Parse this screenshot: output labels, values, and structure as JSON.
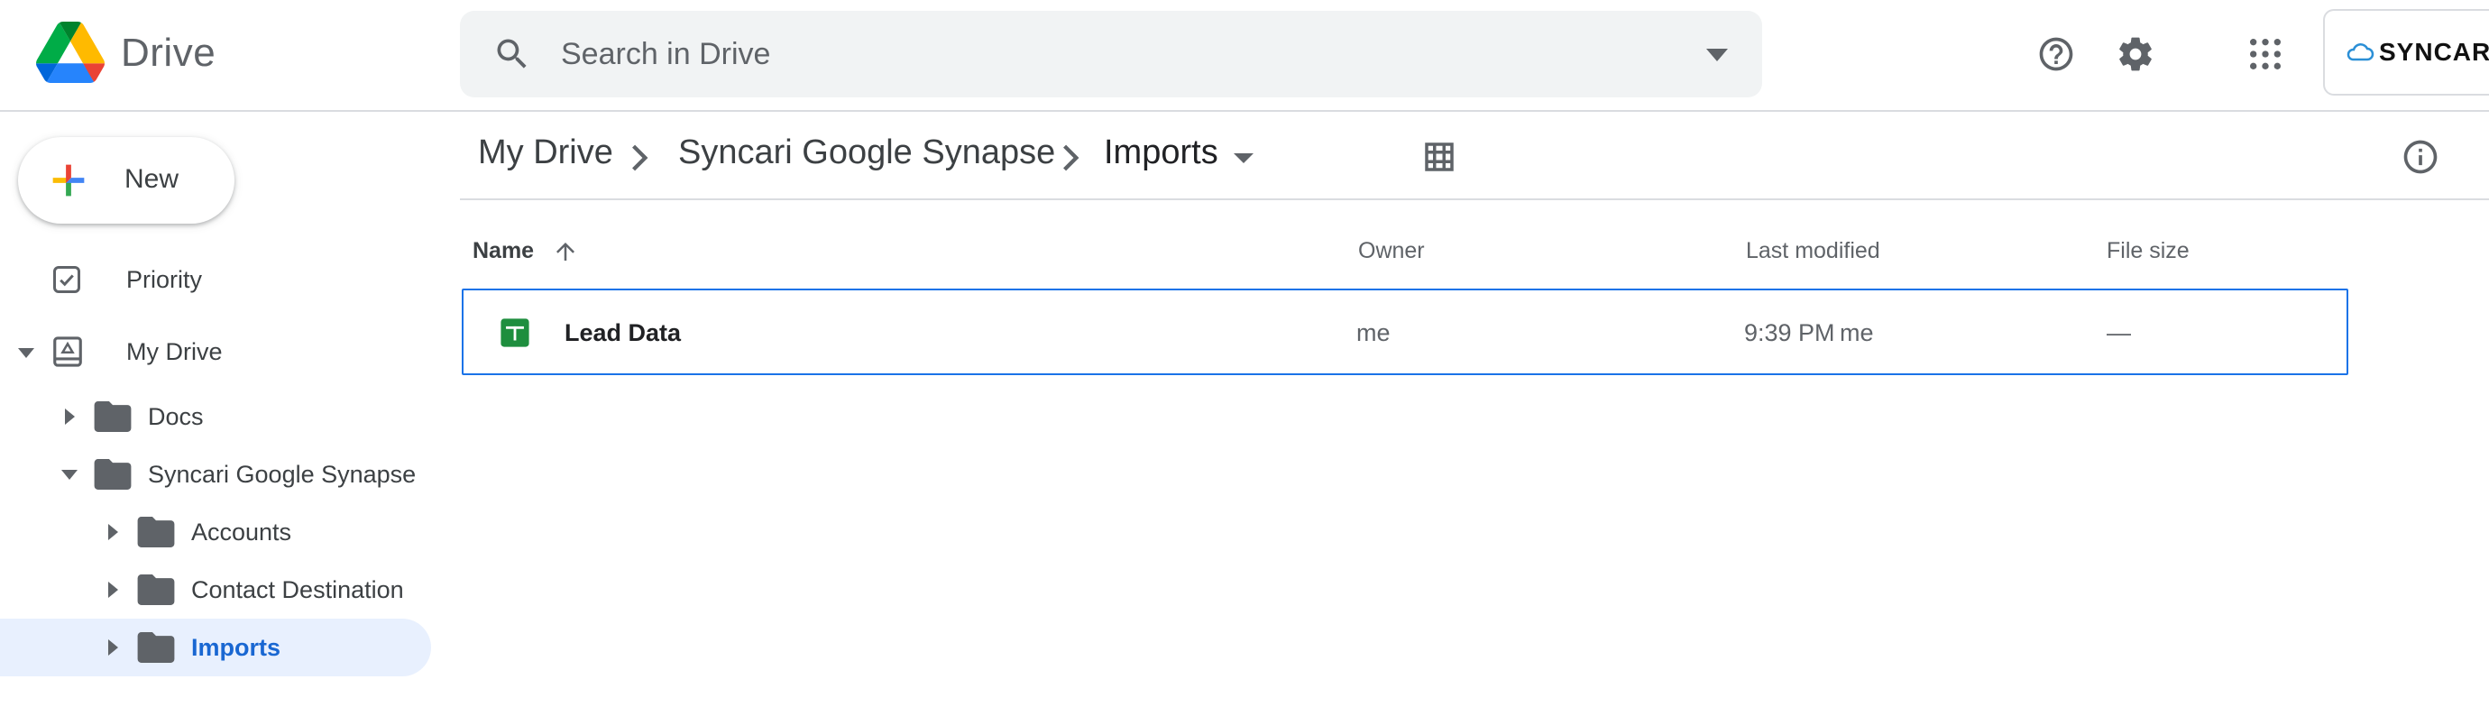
{
  "app": {
    "name": "Drive"
  },
  "search": {
    "placeholder": "Search in Drive",
    "value": ""
  },
  "header": {
    "help": "help-icon",
    "settings": "gear-icon",
    "apps": "apps-grid-icon",
    "account_label": "SYNCARI"
  },
  "new_button": {
    "label": "New"
  },
  "sidebar": {
    "items": [
      {
        "label": "Priority",
        "icon": "priority-checkbox-icon"
      },
      {
        "label": "My Drive",
        "icon": "my-drive-icon",
        "expanded": true
      },
      {
        "label": "Docs",
        "icon": "folder-icon",
        "expanded": false
      },
      {
        "label": "Syncari Google Synapse",
        "icon": "folder-icon",
        "expanded": true
      },
      {
        "label": "Accounts",
        "icon": "folder-icon",
        "expanded": false
      },
      {
        "label": "Contact Destination",
        "icon": "folder-icon",
        "expanded": false
      },
      {
        "label": "Imports",
        "icon": "folder-icon",
        "expanded": false,
        "selected": true
      }
    ]
  },
  "breadcrumb": [
    "My Drive",
    "Syncari Google Synapse",
    "Imports"
  ],
  "toolbar": {
    "view": "grid-view-icon",
    "info": "info-icon"
  },
  "table": {
    "columns": [
      "Name",
      "Owner",
      "Last modified",
      "File size"
    ],
    "sort": {
      "column": "Name",
      "direction": "ascending"
    },
    "rows": [
      {
        "name": "Lead Data",
        "type_icon": "google-sheets-icon",
        "owner": "me",
        "modified_time": "9:39 PM",
        "modified_by": "me",
        "size": "—"
      }
    ]
  },
  "colors": {
    "accent": "#1a73e8",
    "selected_bg": "#e8f0fe",
    "sheets_green": "#1e8e3e",
    "text_muted": "#5f6368"
  }
}
